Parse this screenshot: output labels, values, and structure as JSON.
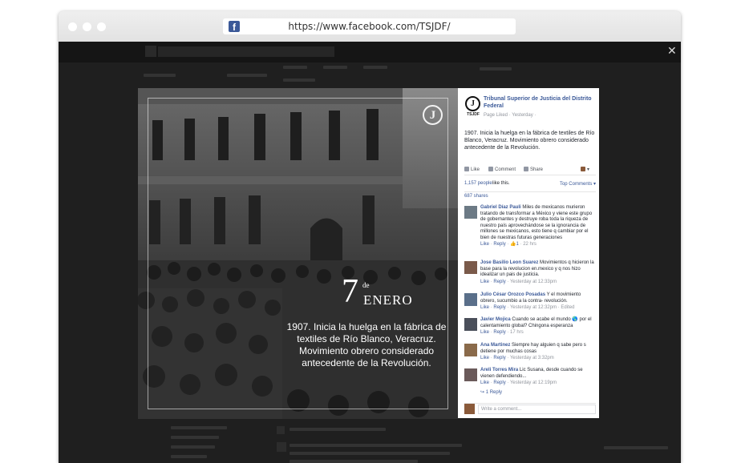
{
  "browser": {
    "url": "https://www.facebook.com/TSJDF/",
    "favicon": "facebook-icon"
  },
  "photo": {
    "badge": "J",
    "day": "7",
    "de": "de",
    "month": "ENERO",
    "caption": "1907. Inicia la huelga en la fábrica de textiles de Río Blanco, Veracruz. Movimiento obrero considerado antecedente de la Revolución."
  },
  "post": {
    "page_name": "Tribunal Superior de Justicia del Distrito Federal",
    "logo_label": "TSJDF",
    "meta": "Page Liked · Yesterday ·",
    "text": "1907. Inicia la huelga en la fábrica de textiles de Río Blanco, Veracruz. Movimiento obrero considerado antecedente de la Revolución.",
    "actions": {
      "like": "Like",
      "comment": "Comment",
      "share": "Share"
    },
    "likes_count": "1,157 people",
    "likes_suffix": "like this.",
    "top_comments": "Top Comments ▾",
    "shares": "687 shares",
    "composer_placeholder": "Write a comment...",
    "reply_count": "1 Reply"
  },
  "comments": [
    {
      "author": "Gabriel Díaz Pauli",
      "text": "Miles de mexicanos murieron tratando de transformar a México y viene este grupo de gobernantes y destruye roba toda la riqueza de nuestro país aprovechándose se la ignorancia de millones se mexicanos, esto tiene q cambiar por el bien de nuestras futuras generaciones",
      "like": "Like",
      "reply": "Reply",
      "likes": "1",
      "time": "22 hrs"
    },
    {
      "author": "Jose Basilio Leon Suarez",
      "text": "Movimientos q hicieron la base para la revolucion en.mexico y q nos hizo idealizar un pais de justicia.",
      "like": "Like",
      "reply": "Reply",
      "time": "Yesterday at 12:33pm"
    },
    {
      "author": "Julio César Orozco Posadas",
      "text": "Y el movimiento obrero, sucumbio a la contra- revolución.",
      "like": "Like",
      "reply": "Reply",
      "time": "Yesterday at 12:32pm · Edited"
    },
    {
      "author": "Javier Mojica",
      "text": "Cuando se acabe el mundo 🌎 por el calentamiento global? Chingona esperanza",
      "like": "Like",
      "reply": "Reply",
      "time": "17 hrs"
    },
    {
      "author": "Ana Martinez",
      "text": "Siempre hay alguien q sabe pero s detiene por muchas cosas",
      "like": "Like",
      "reply": "Reply",
      "time": "Yesterday at 3:32pm"
    },
    {
      "author": "Areli Torres Mira",
      "text": "Lic Susana, desde cuando se vienen defendiendo...",
      "like": "Like",
      "reply": "Reply",
      "time": "Yesterday at 12:19pm"
    }
  ]
}
